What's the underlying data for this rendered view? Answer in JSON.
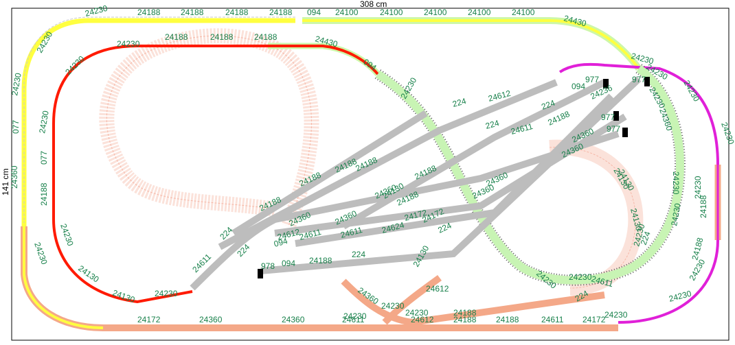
{
  "plan": {
    "width_label": "308 cm",
    "height_label": "141 cm"
  },
  "colors": {
    "yellow": "#ffff40",
    "red": "#ff1a00",
    "magenta": "#e020d8",
    "light_green": "#c8f4b4",
    "peach": "#f4a888",
    "gray": "#bdbdbd",
    "pink_dashed": "#f8c8b8",
    "label": "#17804a"
  },
  "track_labels": [
    "24230",
    "24188",
    "24188",
    "24188",
    "24188",
    "094",
    "24100",
    "24100",
    "24100",
    "24100",
    "24100",
    "24430",
    "24230",
    "24188",
    "24188",
    "24188",
    "24430",
    "094",
    "24230",
    "24230",
    "24230",
    "077",
    "24230",
    "24360",
    "077",
    "24188",
    "24230",
    "24230",
    "24130",
    "24130",
    "24230",
    "24172",
    "24360",
    "24360",
    "24611",
    "24612",
    "24188",
    "24188",
    "24611",
    "24172",
    "24230",
    "24230",
    "24230",
    "24188",
    "24230",
    "24230",
    "24230",
    "24230",
    "24130",
    "24130",
    "24230",
    "24230",
    "24230",
    "224",
    "224",
    "24611",
    "24612",
    "094",
    "24611",
    "24611",
    "24624",
    "24172",
    "978",
    "094",
    "24188",
    "224",
    "24188",
    "24188",
    "24360",
    "24188",
    "24188",
    "24360",
    "24188",
    "24360",
    "24188",
    "24172",
    "24360",
    "24360",
    "224",
    "24612",
    "224",
    "24611",
    "094",
    "977",
    "977",
    "977",
    "977",
    "224",
    "24188",
    "24360",
    "24360",
    "24236",
    "24130",
    "24130",
    "24230",
    "24230",
    "24230",
    "24188",
    "24230",
    "24230",
    "24360",
    "224",
    "24611",
    "24612",
    "24230",
    "24230",
    "24188",
    "24360",
    "24230",
    "24130",
    "224",
    "224"
  ]
}
